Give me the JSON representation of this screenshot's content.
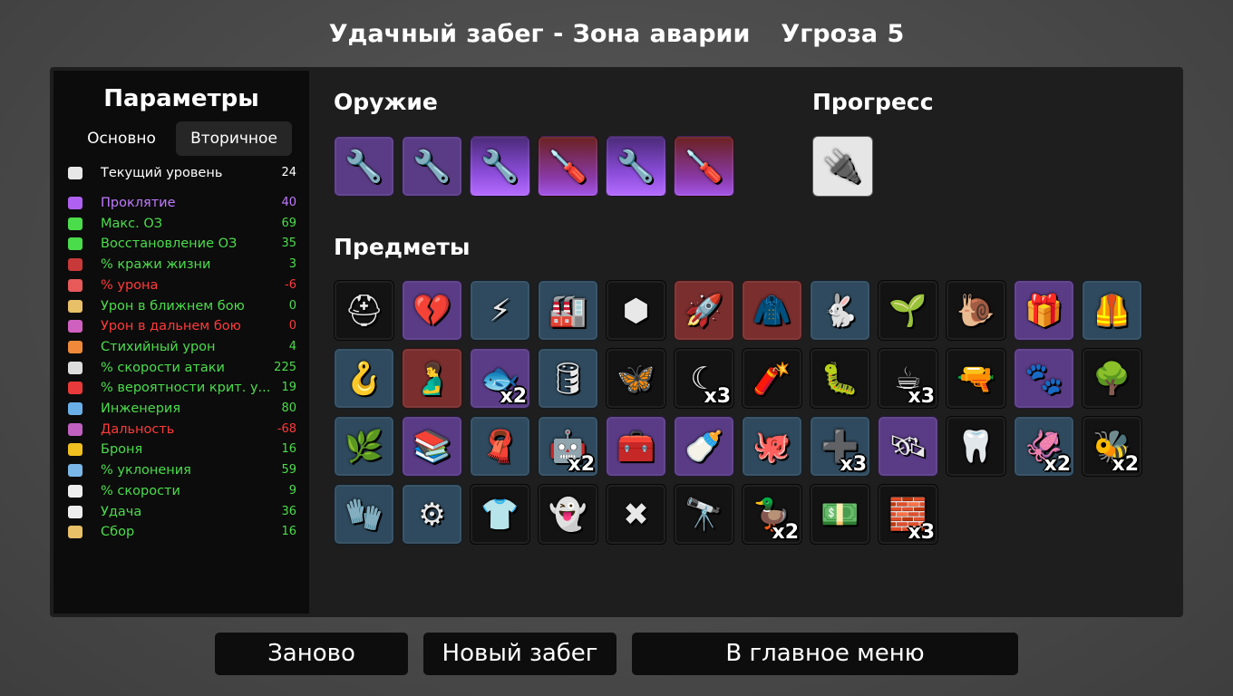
{
  "header": {
    "run_title": "Удачный забег - Зона аварии",
    "threat": "Угроза 5"
  },
  "stats_panel": {
    "title": "Параметры",
    "tabs": [
      {
        "label": "Основно"
      },
      {
        "label": "Вторичное",
        "active": true
      }
    ],
    "level": {
      "label": "Текущий уровень",
      "value": "24",
      "color": "white"
    },
    "stats": [
      {
        "label": "Проклятие",
        "value": "40",
        "color": "purple",
        "icon": "curse-eye-icon",
        "icon_color": "#b060f0"
      },
      {
        "label": "Макс. ОЗ",
        "value": "69",
        "color": "green",
        "icon": "heart-icon",
        "icon_color": "#4bdc4b"
      },
      {
        "label": "Восстановление ОЗ",
        "value": "35",
        "color": "green",
        "icon": "hp-regen-icon",
        "icon_color": "#4bdc4b"
      },
      {
        "label": "% кражи жизни",
        "value": "3",
        "color": "green",
        "icon": "lifesteal-fangs-icon",
        "icon_color": "#c83a3a"
      },
      {
        "label": "% урона",
        "value": "-6",
        "color": "red",
        "icon": "damage-muscle-icon",
        "icon_color": "#e85a5a"
      },
      {
        "label": "Урон в ближнем бою",
        "value": "0",
        "color": "green",
        "icon": "melee-sword-icon",
        "icon_color": "#e8c068"
      },
      {
        "label": "Урон в дальнем бою",
        "value": "0",
        "color": "red",
        "icon": "ranged-bow-icon",
        "icon_color": "#d060c0"
      },
      {
        "label": "Стихийный урон",
        "value": "4",
        "color": "green",
        "icon": "elemental-flame-icon",
        "icon_color": "#f08a3a"
      },
      {
        "label": "% скорости атаки",
        "value": "225",
        "color": "green",
        "icon": "hourglass-icon",
        "icon_color": "#dddddd"
      },
      {
        "label": "% вероятности крит. у...",
        "value": "19",
        "color": "green",
        "icon": "crit-burst-icon",
        "icon_color": "#e83a3a"
      },
      {
        "label": "Инженерия",
        "value": "80",
        "color": "green",
        "icon": "engineering-wrench-icon",
        "icon_color": "#6ab0e8"
      },
      {
        "label": "Дальность",
        "value": "-68",
        "color": "red",
        "icon": "range-waves-icon",
        "icon_color": "#c060c0"
      },
      {
        "label": "Броня",
        "value": "16",
        "color": "green",
        "icon": "armor-shield-icon",
        "icon_color": "#f0c020"
      },
      {
        "label": "% уклонения",
        "value": "59",
        "color": "green",
        "icon": "dodge-wind-icon",
        "icon_color": "#7ab8e8"
      },
      {
        "label": "% скорости",
        "value": "9",
        "color": "green",
        "icon": "speed-boot-icon",
        "icon_color": "#eeeeee"
      },
      {
        "label": "Удача",
        "value": "36",
        "color": "green",
        "icon": "luck-dice-icon",
        "icon_color": "#eeeeee"
      },
      {
        "label": "Сбор",
        "value": "16",
        "color": "green",
        "icon": "harvest-wheat-icon",
        "icon_color": "#e8c068"
      }
    ]
  },
  "weapons": {
    "title": "Оружие",
    "items": [
      {
        "name": "wrench-icon",
        "tier": "purple",
        "glyph": "🔧"
      },
      {
        "name": "wrench-icon",
        "tier": "purple",
        "glyph": "🔧"
      },
      {
        "name": "wrench-icon",
        "tier": "legend-purple",
        "glyph": "🔧"
      },
      {
        "name": "screwdriver-icon",
        "tier": "legend-red",
        "glyph": "🪛"
      },
      {
        "name": "wrench-icon",
        "tier": "legend-purple",
        "glyph": "🔧"
      },
      {
        "name": "screwdriver-icon",
        "tier": "legend-red",
        "glyph": "🪛"
      }
    ]
  },
  "progress": {
    "title": "Прогресс",
    "items": [
      {
        "name": "spark-plug-icon",
        "tier": "light",
        "glyph": "🔌"
      }
    ]
  },
  "items": {
    "title": "Предметы",
    "rows": [
      [
        {
          "name": "knight-helmet-icon",
          "tier": "black",
          "glyph": "⛑"
        },
        {
          "name": "frozen-heart-icon",
          "tier": "purple",
          "glyph": "💔"
        },
        {
          "name": "lightning-claw-icon",
          "tier": "blue",
          "glyph": "⚡"
        },
        {
          "name": "factory-icon",
          "tier": "blue",
          "glyph": "🏭"
        },
        {
          "name": "black-rock-icon",
          "tier": "black",
          "glyph": "⬢"
        },
        {
          "name": "rockets-icon",
          "tier": "red",
          "glyph": "🚀"
        },
        {
          "name": "red-hoodie-icon",
          "tier": "red",
          "glyph": "🧥"
        },
        {
          "name": "rabbit-icon",
          "tier": "blue",
          "glyph": "🐇"
        },
        {
          "name": "sprout-icon",
          "tier": "black",
          "glyph": "🌱"
        },
        {
          "name": "snail-icon",
          "tier": "black",
          "glyph": "🐌"
        },
        {
          "name": "gift-box-icon",
          "tier": "purple",
          "glyph": "🎁"
        },
        {
          "name": "leather-vest-icon",
          "tier": "blue",
          "glyph": "🦺"
        }
      ],
      [
        {
          "name": "fishing-hook-icon",
          "tier": "blue",
          "glyph": "🪝"
        },
        {
          "name": "stomach-icon",
          "tier": "red",
          "glyph": "🫃"
        },
        {
          "name": "goldfish-icon",
          "tier": "purple",
          "glyph": "🐟",
          "qty": "x2"
        },
        {
          "name": "barrel-icon",
          "tier": "blue",
          "glyph": "🛢"
        },
        {
          "name": "butterfly-icon",
          "tier": "black",
          "glyph": "🦋"
        },
        {
          "name": "crescent-blade-icon",
          "tier": "black",
          "glyph": "☾",
          "qty": "x3"
        },
        {
          "name": "dynamite-icon",
          "tier": "black",
          "glyph": "🧨"
        },
        {
          "name": "leech-icon",
          "tier": "black",
          "glyph": "🐛"
        },
        {
          "name": "coffee-cup-icon",
          "tier": "black",
          "glyph": "☕",
          "qty": "x3"
        },
        {
          "name": "bullet-icon",
          "tier": "black",
          "glyph": "🔫"
        },
        {
          "name": "tardigrade-icon",
          "tier": "purple",
          "glyph": "🐾"
        },
        {
          "name": "tree-icon",
          "tier": "black",
          "glyph": "🌳"
        }
      ],
      [
        {
          "name": "garden-bed-icon",
          "tier": "blue",
          "glyph": "🌿"
        },
        {
          "name": "book-stack-icon",
          "tier": "purple",
          "glyph": "📚"
        },
        {
          "name": "bandana-icon",
          "tier": "blue",
          "glyph": "🧣"
        },
        {
          "name": "turret-icon",
          "tier": "blue",
          "glyph": "🤖",
          "qty": "x2"
        },
        {
          "name": "toolbox-icon",
          "tier": "purple",
          "glyph": "🧰"
        },
        {
          "name": "baby-bottle-icon",
          "tier": "purple",
          "glyph": "🍼"
        },
        {
          "name": "octopus-icon",
          "tier": "blue",
          "glyph": "🐙"
        },
        {
          "name": "healing-turret-icon",
          "tier": "blue",
          "glyph": "➕",
          "qty": "x3"
        },
        {
          "name": "tripod-turret-icon",
          "tier": "purple",
          "glyph": "🛰"
        },
        {
          "name": "broken-tooth-icon",
          "tier": "black",
          "glyph": "🦷"
        },
        {
          "name": "tentacle-icon",
          "tier": "blue",
          "glyph": "🦑",
          "qty": "x2"
        },
        {
          "name": "bee-icon",
          "tier": "black",
          "glyph": "🐝",
          "qty": "x2"
        }
      ],
      [
        {
          "name": "scarf-icon",
          "tier": "blue",
          "glyph": "🧤"
        },
        {
          "name": "gear-icon",
          "tier": "blue",
          "glyph": "⚙"
        },
        {
          "name": "plaid-shirt-icon",
          "tier": "black",
          "glyph": "👕"
        },
        {
          "name": "ghost-icon",
          "tier": "black",
          "glyph": "👻"
        },
        {
          "name": "barbed-wire-icon",
          "tier": "black",
          "glyph": "✖"
        },
        {
          "name": "small-turret-icon",
          "tier": "black",
          "glyph": "🔭"
        },
        {
          "name": "rubber-duck-icon",
          "tier": "black",
          "glyph": "🦆",
          "qty": "x2"
        },
        {
          "name": "banknote-icon",
          "tier": "black",
          "glyph": "💵"
        },
        {
          "name": "metal-bar-icon",
          "tier": "black",
          "glyph": "🧱",
          "qty": "x3"
        }
      ]
    ]
  },
  "buttons": {
    "restart": "Заново",
    "new_run": "Новый забег",
    "main_menu": "В главное меню"
  }
}
